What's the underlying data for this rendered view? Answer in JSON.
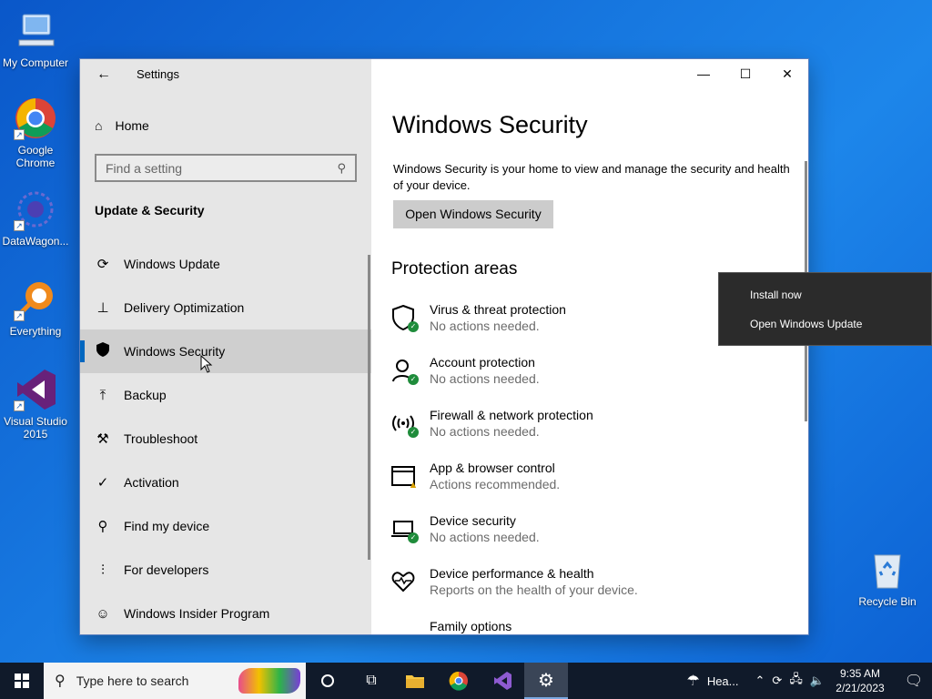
{
  "desktop": {
    "icons": [
      {
        "label": "My Computer"
      },
      {
        "label": "Google Chrome"
      },
      {
        "label": "DataWagon..."
      },
      {
        "label": "Everything"
      },
      {
        "label": "Visual Studio 2015"
      },
      {
        "label": "Recycle Bin"
      }
    ]
  },
  "window": {
    "app_title": "Settings",
    "nav": {
      "home_label": "Home",
      "search_placeholder": "Find a setting",
      "section_title": "Update & Security",
      "items": [
        {
          "label": "Windows Update",
          "icon": "refresh-icon"
        },
        {
          "label": "Delivery Optimization",
          "icon": "delivery-icon"
        },
        {
          "label": "Windows Security",
          "icon": "shield-icon",
          "selected": true
        },
        {
          "label": "Backup",
          "icon": "backup-icon"
        },
        {
          "label": "Troubleshoot",
          "icon": "wrench-icon"
        },
        {
          "label": "Activation",
          "icon": "check-circle-icon"
        },
        {
          "label": "Find my device",
          "icon": "person-location-icon"
        },
        {
          "label": "For developers",
          "icon": "sliders-icon"
        },
        {
          "label": "Windows Insider Program",
          "icon": "insider-cat-icon"
        }
      ]
    },
    "content": {
      "title": "Windows Security",
      "description": "Windows Security is your home to view and manage the security and health of your device.",
      "open_button": "Open Windows Security",
      "protection_title": "Protection areas",
      "areas": [
        {
          "title": "Virus & threat protection",
          "status": "No actions needed.",
          "icon": "shield-check-icon"
        },
        {
          "title": "Account protection",
          "status": "No actions needed.",
          "icon": "person-check-icon"
        },
        {
          "title": "Firewall & network protection",
          "status": "No actions needed.",
          "icon": "wifi-antenna-icon"
        },
        {
          "title": "App & browser control",
          "status": "Actions recommended.",
          "icon": "browser-warning-icon"
        },
        {
          "title": "Device security",
          "status": "No actions needed.",
          "icon": "laptop-check-icon"
        },
        {
          "title": "Device performance & health",
          "status": "Reports on the health of your device.",
          "icon": "heart-pulse-icon"
        },
        {
          "title": "Family options",
          "status": "",
          "icon": "family-icon"
        }
      ]
    }
  },
  "context_menu": {
    "items": [
      "Install now",
      "Open Windows Update"
    ]
  },
  "taskbar": {
    "search_placeholder": "Type here to search",
    "weather_label": "Hea...",
    "time": "9:35 AM",
    "date": "2/21/2023"
  },
  "colors": {
    "accent": "#0067c0",
    "ok_green": "#1f8c3b",
    "warning": "#d8a000"
  }
}
